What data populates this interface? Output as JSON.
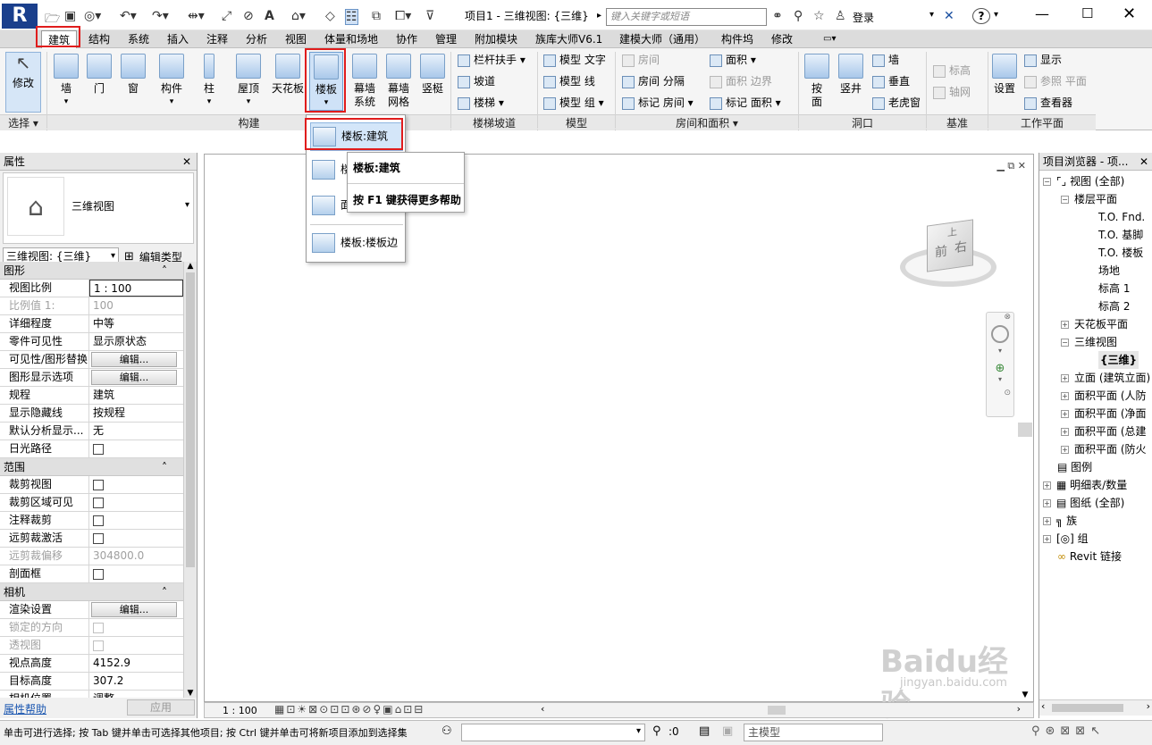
{
  "titlebar": {
    "doc_title": "项目1 - 三维视图: {三维}",
    "search_placeholder": "键入关键字或短语",
    "login": "登录",
    "help": "?"
  },
  "tabs": [
    "建筑",
    "结构",
    "系统",
    "插入",
    "注释",
    "分析",
    "视图",
    "体量和场地",
    "协作",
    "管理",
    "附加模块",
    "族库大师V6.1",
    "建模大师（通用）",
    "构件坞",
    "修改"
  ],
  "ribbon": {
    "select": {
      "modify": "修改",
      "panel": "选择 ▾"
    },
    "build": {
      "wall": "墙",
      "door": "门",
      "window": "窗",
      "component": "构件",
      "column": "柱",
      "roof": "屋顶",
      "ceiling": "天花板",
      "floor": "楼板",
      "curtain_system_1": "幕墙",
      "curtain_system_2": "系统",
      "curtain_grid_1": "幕墙",
      "curtain_grid_2": "网格",
      "mullion": "竖梃",
      "panel": "构建"
    },
    "circulation": {
      "railing": "栏杆扶手",
      "ramp": "坡道",
      "stair": "楼梯",
      "panel": "楼梯坡道"
    },
    "model": {
      "text": "模型 文字",
      "line": "模型 线",
      "group": "模型 组",
      "panel": "模型"
    },
    "room": {
      "room": "房间",
      "room_sep_1": "房间",
      "room_sep_2": "分隔",
      "tag_room_1": "标记",
      "tag_room_2": "房间",
      "area": "面积",
      "area_boundary": "面积 边界",
      "tag_area_1": "标记",
      "tag_area_2": "面积",
      "panel": "房间和面积 ▾"
    },
    "opening": {
      "by_face_1": "按",
      "by_face_2": "面",
      "shaft": "竖井",
      "wall": "墙",
      "vertical": "垂直",
      "dormer": "老虎窗",
      "panel": "洞口"
    },
    "datum": {
      "level": "标高",
      "grid": "轴网",
      "panel": "基准"
    },
    "workplane": {
      "set": "设置",
      "show": "显示",
      "ref_plane": "参照 平面",
      "viewer": "查看器",
      "panel": "工作平面"
    }
  },
  "dropdown": {
    "item1": "楼板:建筑",
    "item2": "楼",
    "item3": "面",
    "item4": "楼板:楼板边"
  },
  "tooltip": {
    "title": "楼板:建筑",
    "hint": "按 F1 键获得更多帮助"
  },
  "properties": {
    "title": "属性",
    "type_name": "三维视图",
    "view_selector": "三维视图: {三维}",
    "edit_type": "编辑类型",
    "groups": [
      {
        "name": "图形",
        "rows": [
          {
            "k": "视图比例",
            "v": "1 : 100"
          },
          {
            "k": "比例值 1:",
            "v": "100"
          },
          {
            "k": "详细程度",
            "v": "中等"
          },
          {
            "k": "零件可见性",
            "v": "显示原状态"
          },
          {
            "k": "可见性/图形替换",
            "v": "编辑..."
          },
          {
            "k": "图形显示选项",
            "v": "编辑..."
          },
          {
            "k": "规程",
            "v": "建筑"
          },
          {
            "k": "显示隐藏线",
            "v": "按规程"
          },
          {
            "k": "默认分析显示...",
            "v": "无"
          },
          {
            "k": "日光路径",
            "v": ""
          }
        ]
      },
      {
        "name": "范围",
        "rows": [
          {
            "k": "裁剪视图",
            "v": ""
          },
          {
            "k": "裁剪区域可见",
            "v": ""
          },
          {
            "k": "注释裁剪",
            "v": ""
          },
          {
            "k": "远剪裁激活",
            "v": ""
          },
          {
            "k": "远剪裁偏移",
            "v": "304800.0"
          },
          {
            "k": "剖面框",
            "v": ""
          }
        ]
      },
      {
        "name": "相机",
        "rows": [
          {
            "k": "渲染设置",
            "v": "编辑..."
          },
          {
            "k": "锁定的方向",
            "v": ""
          },
          {
            "k": "透视图",
            "v": ""
          },
          {
            "k": "视点高度",
            "v": "4152.9"
          },
          {
            "k": "目标高度",
            "v": "307.2"
          },
          {
            "k": "相机位置",
            "v": "调整"
          }
        ]
      }
    ],
    "help": "属性帮助",
    "apply": "应用"
  },
  "browser": {
    "title": "项目浏览器 - 项...",
    "items": [
      "视图 (全部)",
      "楼层平面",
      "T.O. Fnd.",
      "T.O. 基脚",
      "T.O. 楼板",
      "场地",
      "标高 1",
      "标高 2",
      "天花板平面",
      "三维视图",
      "{三维}",
      "立面 (建筑立面)",
      "面积平面 (人防",
      "面积平面 (净面",
      "面积平面 (总建",
      "面积平面 (防火",
      "图例",
      "明细表/数量",
      "图纸 (全部)",
      "族",
      "组",
      "Revit 链接"
    ]
  },
  "viewcube": {
    "front": "前",
    "right": "右",
    "top": "上"
  },
  "viewctl": {
    "scale": "1 : 100"
  },
  "status": {
    "message": "单击可进行选择; 按 Tab 键并单击可选择其他项目; 按 Ctrl 键并单击可将新项目添加到选择集",
    "count": ":0",
    "model": "主模型"
  },
  "watermark": {
    "text": "Baidu经验",
    "url": "jingyan.baidu.com"
  }
}
